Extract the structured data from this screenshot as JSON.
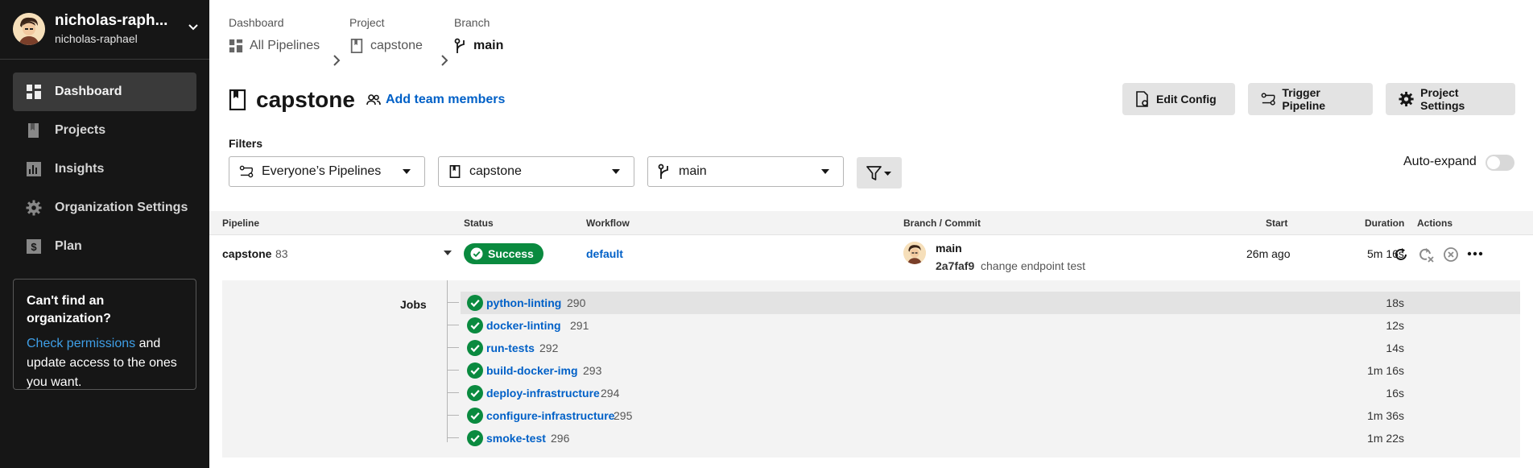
{
  "user": {
    "display_name": "nicholas-raph...",
    "username": "nicholas-raphael"
  },
  "sidebar": {
    "items": [
      {
        "label": "Dashboard",
        "icon": "dashboard-icon",
        "active": true
      },
      {
        "label": "Projects",
        "icon": "projects-icon"
      },
      {
        "label": "Insights",
        "icon": "insights-icon"
      },
      {
        "label": "Organization Settings",
        "icon": "gear-icon"
      },
      {
        "label": "Plan",
        "icon": "dollar-icon"
      }
    ],
    "help": {
      "title": "Can't find an organization?",
      "link": "Check permissions",
      "text": " and update access to the ones you want."
    }
  },
  "breadcrumb": {
    "dashboard": {
      "caption": "Dashboard",
      "value": "All Pipelines"
    },
    "project": {
      "caption": "Project",
      "value": "capstone"
    },
    "branch": {
      "caption": "Branch",
      "value": "main"
    }
  },
  "project": {
    "title": "capstone",
    "add_team": "Add team members"
  },
  "buttons": {
    "edit_config": "Edit Config",
    "trigger": "Trigger Pipeline",
    "settings": "Project Settings"
  },
  "filters": {
    "label": "Filters",
    "pipelines": "Everyone’s Pipelines",
    "project": "capstone",
    "branch": "main",
    "auto_expand": "Auto-expand",
    "auto_expand_on": false
  },
  "table": {
    "headers": {
      "pipeline": "Pipeline",
      "status": "Status",
      "workflow": "Workflow",
      "branch_commit": "Branch / Commit",
      "start": "Start",
      "duration": "Duration",
      "actions": "Actions"
    },
    "pipeline": {
      "name": "capstone",
      "number": "83",
      "status": "Success",
      "workflow": "default",
      "branch": "main",
      "commit_hash": "2a7faf9",
      "commit_msg": "change endpoint test",
      "start": "26m ago",
      "duration": "5m 16s"
    },
    "jobs_label": "Jobs",
    "jobs": [
      {
        "name": "python-linting",
        "number": "290",
        "duration": "18s"
      },
      {
        "name": "docker-linting",
        "number": "291",
        "duration": "12s"
      },
      {
        "name": "run-tests",
        "number": "292",
        "duration": "14s"
      },
      {
        "name": "build-docker-img",
        "number": "293",
        "duration": "1m 16s"
      },
      {
        "name": "deploy-infrastructure",
        "number": "294",
        "duration": "16s"
      },
      {
        "name": "configure-infrastructure",
        "number": "295",
        "duration": "1m 36s"
      },
      {
        "name": "smoke-test",
        "number": "296",
        "duration": "1m 22s"
      }
    ]
  },
  "colors": {
    "success": "#0a8a3f",
    "link": "#0060c7",
    "sidebar": "#161616"
  }
}
